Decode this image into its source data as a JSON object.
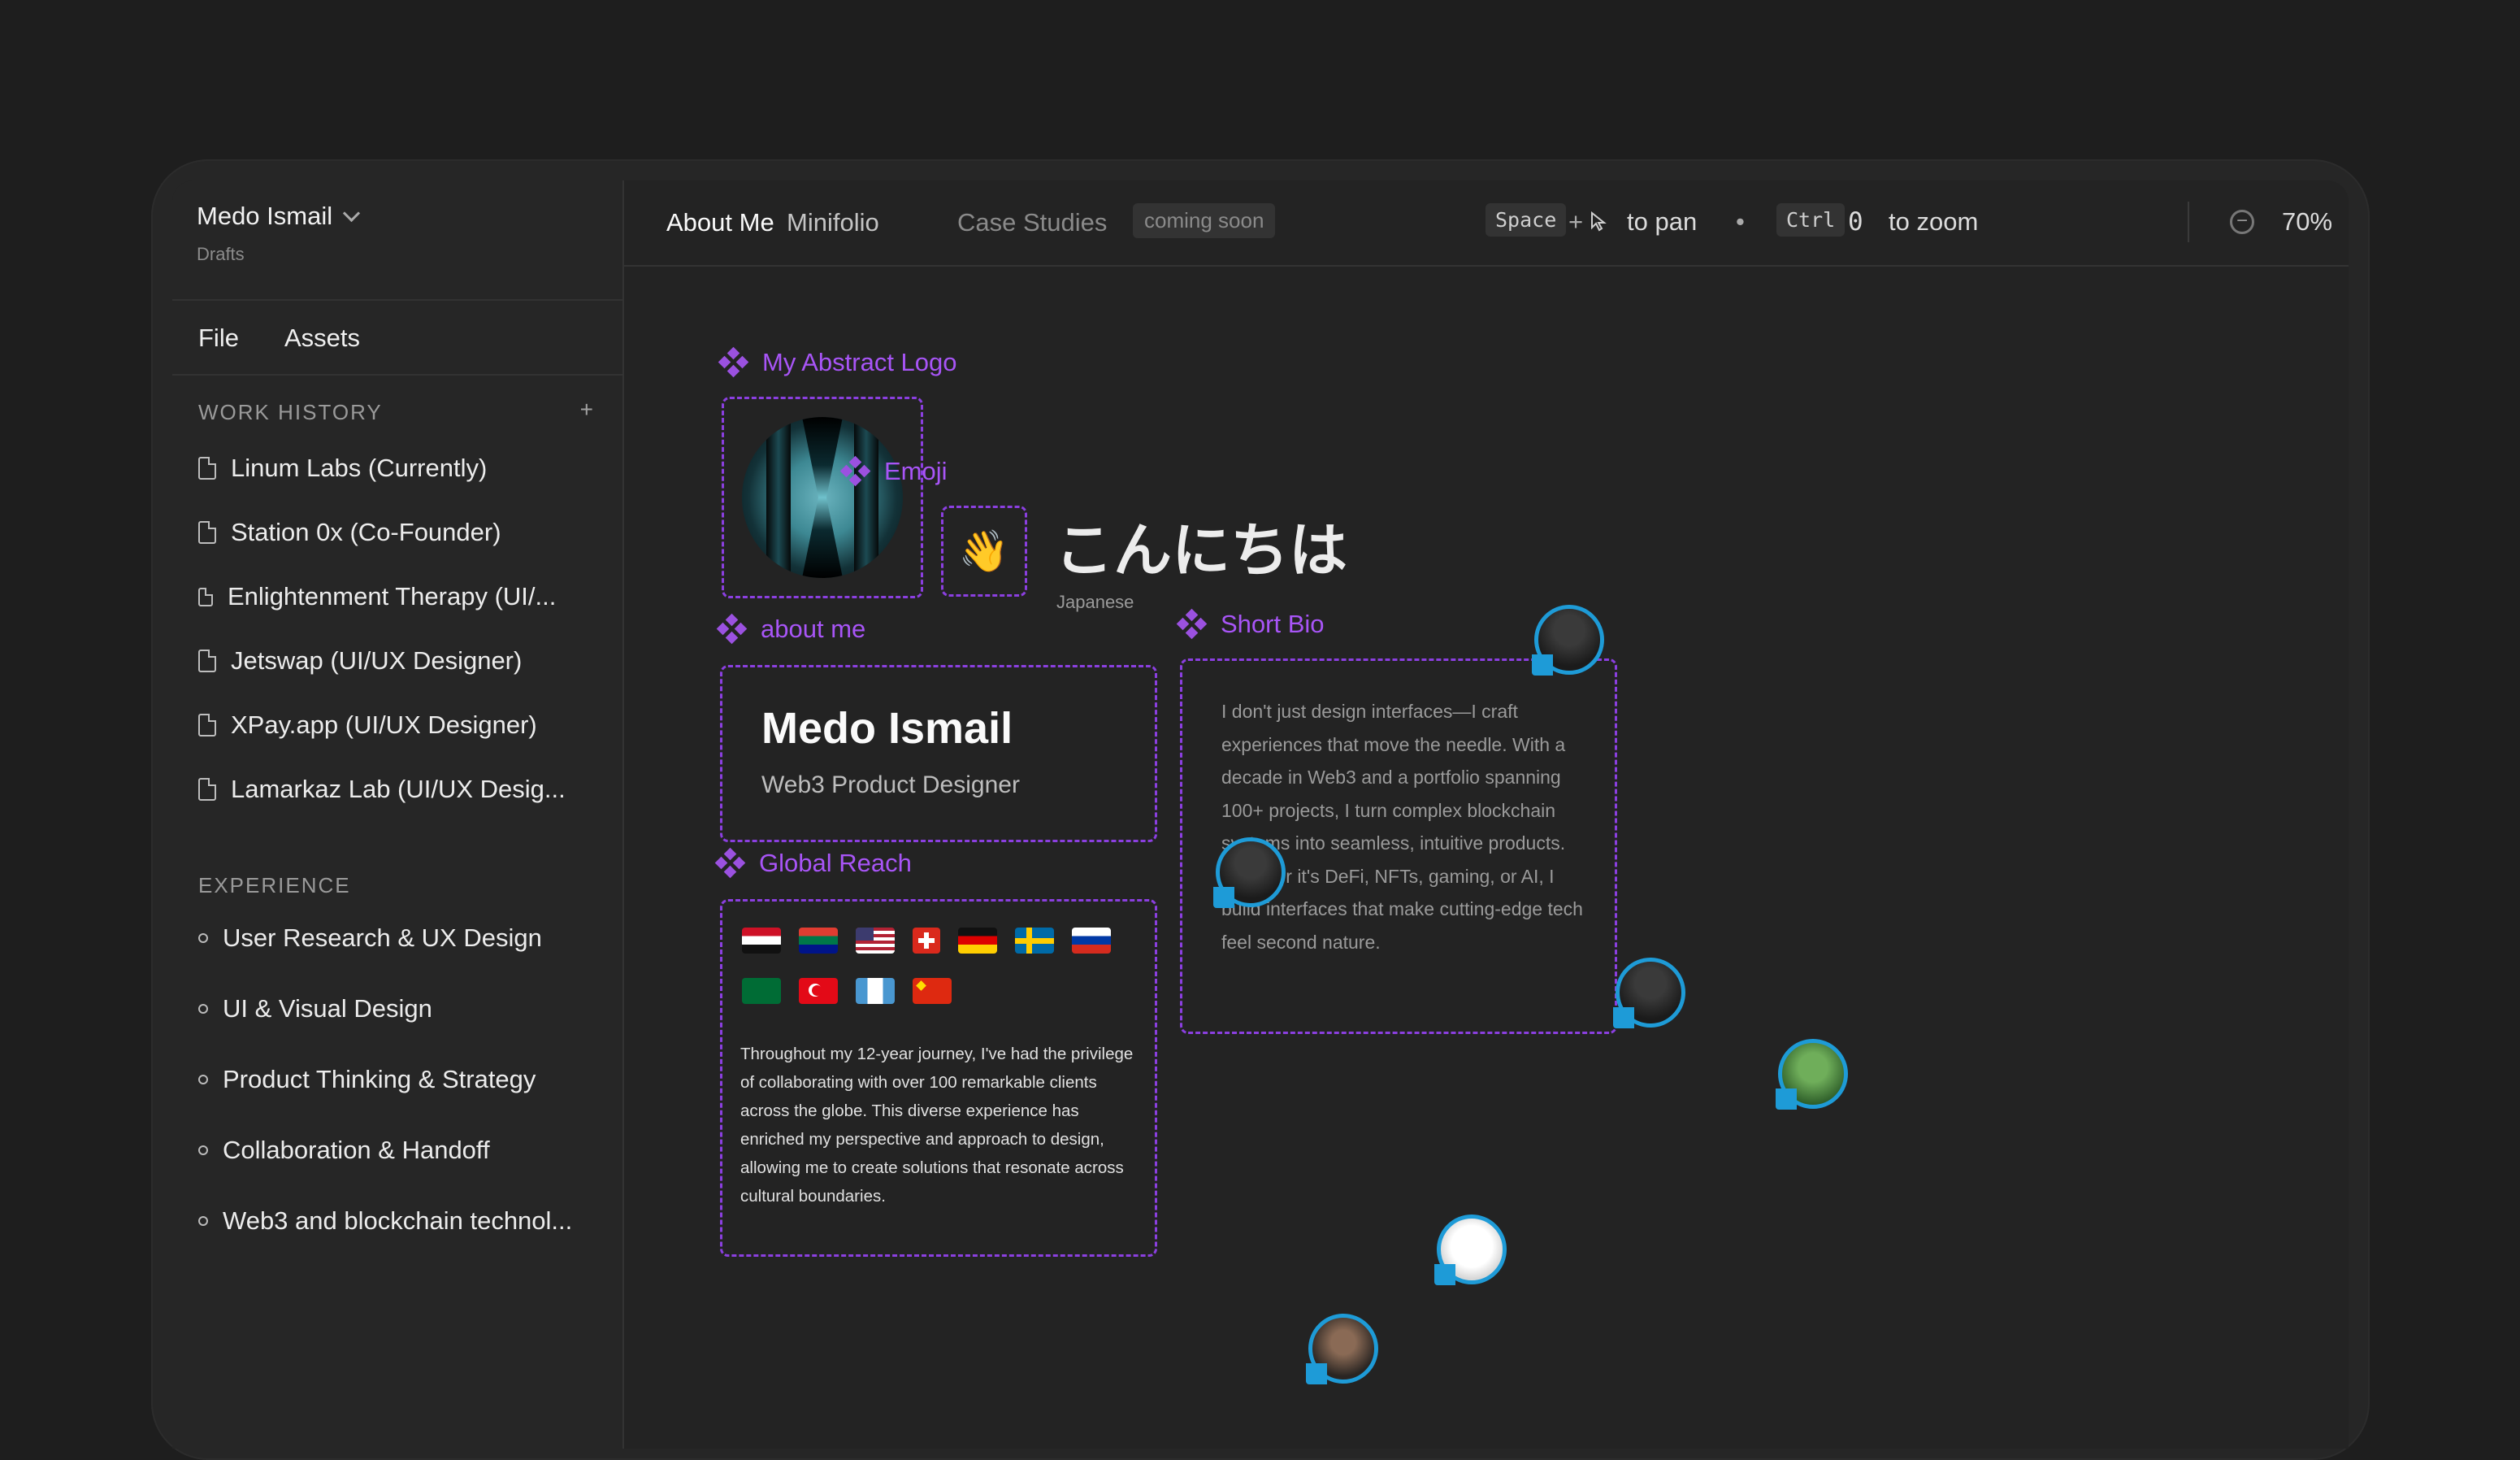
{
  "project": {
    "name": "Medo Ismail",
    "location": "Drafts"
  },
  "menu": {
    "file": "File",
    "assets": "Assets"
  },
  "work_history": {
    "title": "WORK HISTORY",
    "add": "+",
    "items": [
      "Linum Labs (Currently)",
      "Station 0x (Co-Founder)",
      "Enlightenment Therapy (UI/...",
      "Jetswap (UI/UX Designer)",
      "XPay.app (UI/UX Designer)",
      "Lamarkaz Lab (UI/UX Desig..."
    ]
  },
  "experience": {
    "title": "EXPERIENCE",
    "items": [
      "User Research & UX Design",
      "UI & Visual Design",
      "Product Thinking & Strategy",
      "Collaboration & Handoff",
      "Web3 and blockchain technol..."
    ]
  },
  "tabs": {
    "about": "About Me",
    "minifolio": "Minifolio",
    "case_studies": "Case Studies",
    "coming_soon": "coming soon"
  },
  "hints": {
    "space": "Space",
    "plus": "+",
    "pan": "to pan",
    "bullet": "•",
    "ctrl": "Ctrl",
    "zero": "0",
    "zoom": "to zoom"
  },
  "zoom": {
    "value": "70%",
    "minus": "−",
    "plus": "+"
  },
  "canvas": {
    "logo_label": "My Abstract Logo",
    "emoji_label": "Emoji",
    "emoji": "👋",
    "greeting": "こんにちは",
    "greeting_lang": "Japanese",
    "about_label": "about me",
    "name": "Medo Ismail",
    "role": "Web3 Product Designer",
    "reach_label": "Global Reach",
    "reach_text": "Throughout my 12-year journey, I've had the privilege of collaborating with over 100 remarkable clients across the globe. This diverse experience has enriched my perspective and approach to design, allowing me to create solutions that resonate across cultural boundaries.",
    "bio_label": "Short Bio",
    "bio_text": "I don't just design interfaces—I craft experiences that move the needle. With a decade in Web3 and a portfolio spanning 100+ projects, I turn complex blockchain systems into seamless, intuitive products. Whether it's DeFi, NFTs, gaming, or AI, I build interfaces that make cutting-edge tech feel second nature."
  },
  "colors": {
    "accent": "#a855f7",
    "avatar_ring": "#1e9bd7",
    "bg": "#1e1e1e"
  }
}
